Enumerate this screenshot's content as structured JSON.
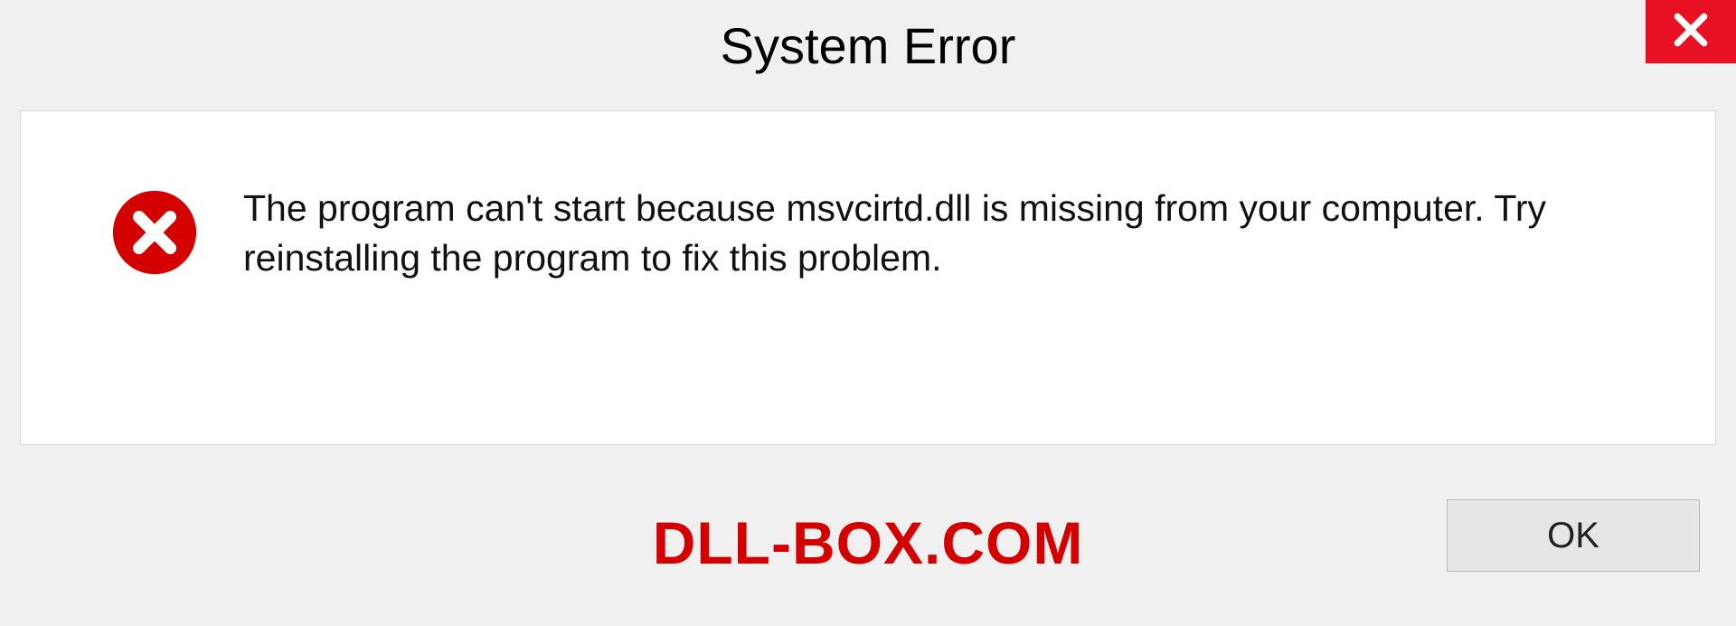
{
  "titlebar": {
    "title": "System Error"
  },
  "dialog": {
    "message": "The program can't start because msvcirtd.dll is missing from your computer. Try reinstalling the program to fix this problem."
  },
  "footer": {
    "watermark": "DLL-BOX.COM",
    "ok_label": "OK"
  },
  "colors": {
    "close_bg": "#e81123",
    "error_icon": "#d40000",
    "watermark": "#d40000"
  }
}
